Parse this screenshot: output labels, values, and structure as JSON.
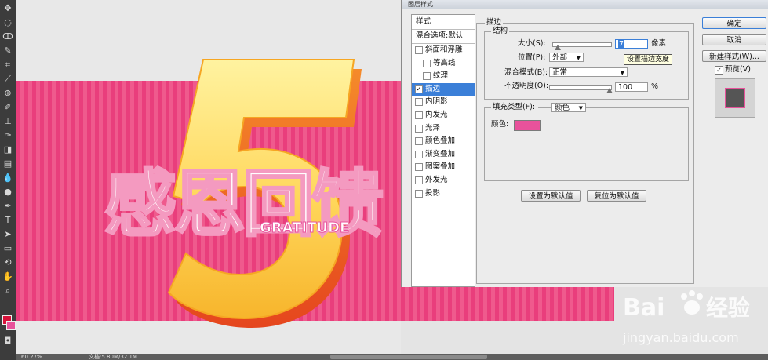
{
  "dialog": {
    "title": "图层样式",
    "styles_header": "样式",
    "blending_default": "混合选项:默认",
    "style_items": [
      {
        "label": "斜面和浮雕",
        "checked": false,
        "indent": false
      },
      {
        "label": "等高线",
        "checked": false,
        "indent": true
      },
      {
        "label": "纹理",
        "checked": false,
        "indent": true
      },
      {
        "label": "描边",
        "checked": true,
        "indent": false,
        "selected": true
      },
      {
        "label": "内阴影",
        "checked": false,
        "indent": false
      },
      {
        "label": "内发光",
        "checked": false,
        "indent": false
      },
      {
        "label": "光泽",
        "checked": false,
        "indent": false
      },
      {
        "label": "颜色叠加",
        "checked": false,
        "indent": false
      },
      {
        "label": "渐变叠加",
        "checked": false,
        "indent": false
      },
      {
        "label": "图案叠加",
        "checked": false,
        "indent": false
      },
      {
        "label": "外发光",
        "checked": false,
        "indent": false
      },
      {
        "label": "投影",
        "checked": false,
        "indent": false
      }
    ],
    "stroke": {
      "group_title": "描边",
      "structure_title": "结构",
      "size_label": "大小(S):",
      "size_value": "7",
      "size_unit": "像素",
      "size_slider_fraction": 0.03,
      "position_label": "位置(P):",
      "position_value": "外部",
      "blend_label": "混合模式(B):",
      "blend_value": "正常",
      "opacity_label": "不透明度(O):",
      "opacity_value": "100",
      "opacity_unit": "%",
      "opacity_fraction": 1.0,
      "fill_type_label": "填充类型(F):",
      "fill_type_value": "颜色",
      "color_label": "颜色:",
      "stroke_color": "#e8529b",
      "set_default": "设置为默认值",
      "reset_default": "复位为默认值"
    },
    "buttons": {
      "ok": "确定",
      "cancel": "取消",
      "new_style": "新建样式(W)...",
      "preview_label": "预览(V)",
      "preview_checked": true
    },
    "tooltip": "设置描边宽度"
  },
  "status": {
    "zoom": "60.27%",
    "doc": "文档:5.80M/32.1M"
  },
  "colors": {
    "foreground": "#d8123a",
    "background": "#e8529b",
    "accent_selected": "#3b7fd8"
  },
  "artwork": {
    "main_text": "感恩回馈",
    "sub_text": "GRATITUDE",
    "numeral": "5"
  },
  "watermark": {
    "brand_left": "Bai",
    "brand_right": "经验",
    "url": "jingyan.baidu.com"
  }
}
